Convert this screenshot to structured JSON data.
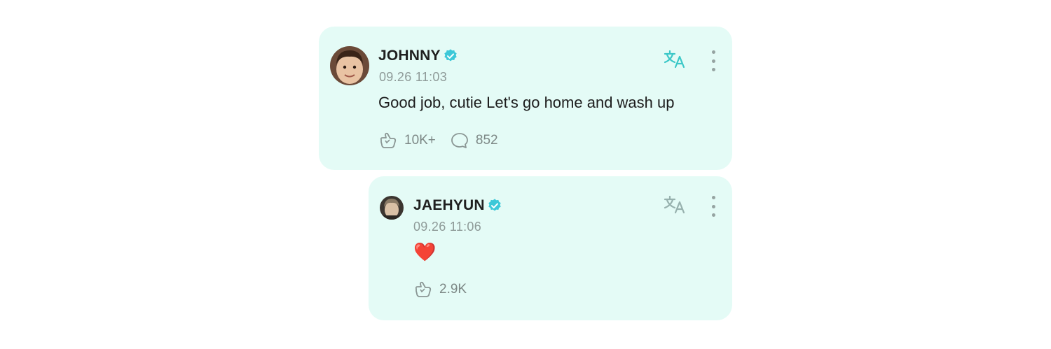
{
  "posts": [
    {
      "author": "JOHNNY",
      "time": "09.26 11:03",
      "text": "Good job, cutie Let's go home and wash up",
      "likes": "10K+",
      "comments": "852"
    },
    {
      "author": "JAEHYUN",
      "time": "09.26 11:06",
      "text": "❤️",
      "likes": "2.9K"
    }
  ],
  "icons": {
    "verified": "verified-badge-icon",
    "translate": "translate-icon",
    "more": "more-vertical-icon",
    "like": "like-hand-icon",
    "comment": "comment-bubble-icon"
  },
  "colors": {
    "card_background": "#e4fbf6",
    "accent": "#3cc8c8",
    "muted_text": "#8e9a98"
  }
}
